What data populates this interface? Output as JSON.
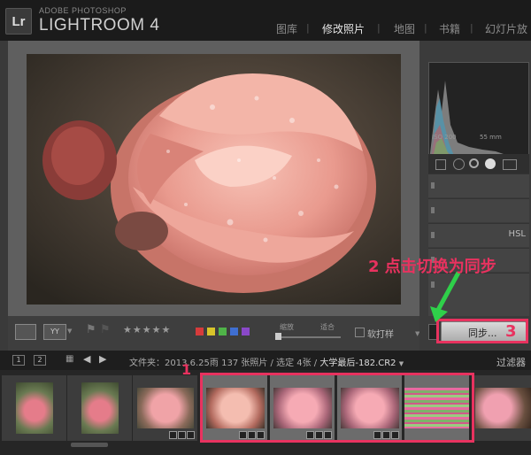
{
  "app": {
    "logo": "Lr",
    "brand_small": "ADOBE PHOTOSHOP",
    "brand_main": "LIGHTROOM 4"
  },
  "modules": [
    {
      "label": "图库",
      "active": false
    },
    {
      "label": "修改照片",
      "active": true
    },
    {
      "label": "地图",
      "active": false
    },
    {
      "label": "书籍",
      "active": false
    },
    {
      "label": "幻灯片放",
      "active": false
    }
  ],
  "histogram": {
    "iso": "ISO 200",
    "focal": "55 mm"
  },
  "panels": {
    "hsl_label": "HSL"
  },
  "toolbar": {
    "stars": "★★★★★",
    "zoom_label": "缩放",
    "fit_label": "适合",
    "softproof_label": "软打样",
    "color_labels": [
      "#d63b3b",
      "#d8c42a",
      "#4fb448",
      "#3f6fd1",
      "#8a48c9"
    ]
  },
  "sync": {
    "label": "同步..."
  },
  "annotations": {
    "one": "1",
    "two": "2 点击切换为同步",
    "three": "3"
  },
  "filmstrip": {
    "screen1": "1",
    "screen2": "2",
    "folder": "文件夹：2013.6.25雨",
    "count": "137 张照片 / 选定 4张 /",
    "file": "大学最后-182.CR2",
    "filter_label": "过滤器"
  },
  "colors": {
    "accent": "#e8325f",
    "arrow": "#2fd04a",
    "rose": "#e9a69e"
  }
}
